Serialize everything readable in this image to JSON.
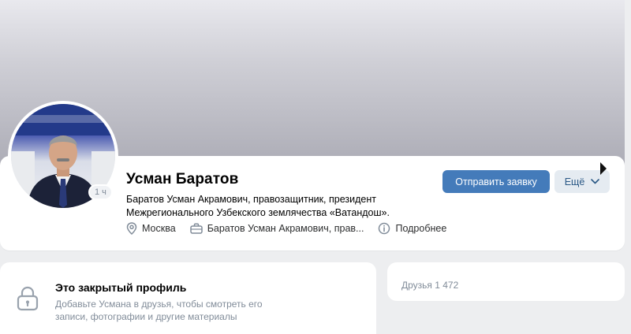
{
  "profile": {
    "name": "Усман Баратов",
    "status_line1": "Баратов Усман Акрамович, правозащитник, президент",
    "status_line2": "Межрегионального Узбекского землячества «Ватандош».",
    "online": "1 ч",
    "city": "Москва",
    "work": "Баратов Усман Акрамович, прав...",
    "more_info": "Подробнее"
  },
  "actions": {
    "add_friend": "Отправить заявку",
    "more": "Ещё"
  },
  "closed_profile": {
    "title": "Это закрытый профиль",
    "description": "Добавьте Усмана в друзья, чтобы смотреть его записи, фотографии и другие материалы"
  },
  "friends": {
    "label": "Друзья 1 472"
  },
  "colors": {
    "accent": "#447bba",
    "secondary_button": "#e5ebf1",
    "muted_text": "#818c99"
  },
  "icons": [
    "location-icon",
    "briefcase-icon",
    "info-icon",
    "lock-icon",
    "chevron-down-icon"
  ]
}
